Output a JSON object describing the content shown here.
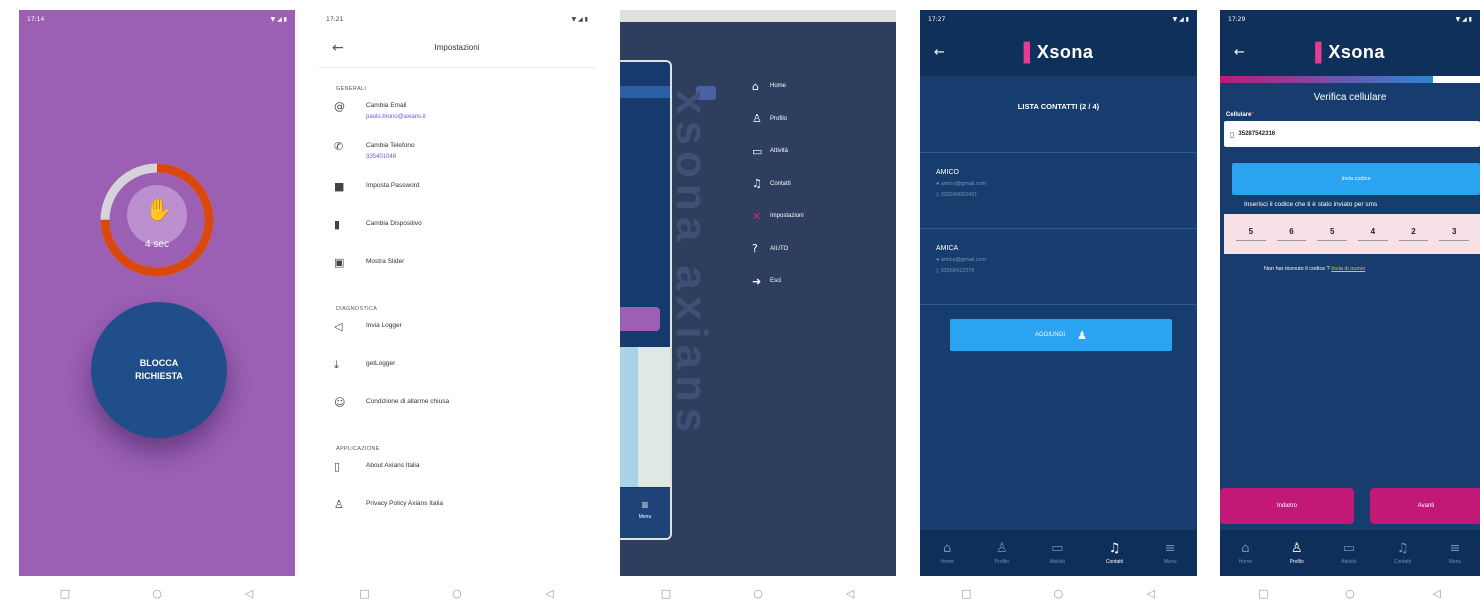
{
  "phone1": {
    "status_time": "17:14",
    "timer_text": "4 sec",
    "timer_progress": 0.75,
    "block_button": "BLOCCA RICHIESTA",
    "colors": {
      "background": "#9b5fb3",
      "ring": "#d9480f",
      "button": "#1f4e8a"
    }
  },
  "phone2": {
    "status_time": "17:21",
    "title": "Impostazioni",
    "sections": {
      "general": "GENERALI",
      "diagnostics": "DIAGNOSTICA",
      "application": "APPLICAZIONE"
    },
    "items": {
      "email": {
        "label": "Cambia Email",
        "value": "paolo.bruno@axians.it",
        "icon": "at-icon"
      },
      "phone": {
        "label": "Cambia Telefono",
        "value": "335401048",
        "icon": "phone-icon"
      },
      "password": {
        "label": "Imposta Password",
        "icon": "lock-icon"
      },
      "device": {
        "label": "Cambia Dispositivo",
        "icon": "device-icon"
      },
      "slider": {
        "label": "Mostra Slider",
        "icon": "image-icon"
      },
      "logger": {
        "label": "Invia Logger",
        "icon": "send-icon"
      },
      "getlogger": {
        "label": "getLogger",
        "icon": "download-icon"
      },
      "alarm": {
        "label": "Condizione di allarme chiusa",
        "icon": "alarm-icon"
      },
      "about": {
        "label": "About Axians Italia",
        "icon": "document-icon"
      },
      "privacy": {
        "label": "Privacy Policy Axians Italia",
        "icon": "person-doc-icon"
      }
    }
  },
  "phone3": {
    "brand_text": "xsona axians",
    "card_menu_label": "Menu",
    "nav": [
      {
        "label": "Home",
        "icon": "home-icon",
        "glyph": "⌂"
      },
      {
        "label": "Profilo",
        "icon": "user-icon",
        "glyph": "♙"
      },
      {
        "label": "Attività",
        "icon": "folder-icon",
        "glyph": "▭"
      },
      {
        "label": "Contatti",
        "icon": "bell-icon",
        "glyph": "♫"
      },
      {
        "label": "Impostazioni",
        "icon": "settings-x-icon",
        "glyph": "✕"
      },
      {
        "label": "AIUTO",
        "icon": "question-icon",
        "glyph": "?"
      },
      {
        "label": "Esci",
        "icon": "exit-icon",
        "glyph": "➜"
      }
    ]
  },
  "phone4": {
    "status_time": "17:27",
    "logo": "Xsona",
    "title": "LISTA CONTATTI  (2 / 4)",
    "contacts": [
      {
        "name": "AMICO",
        "email": "amico@gmail.com",
        "phone": "333249663431"
      },
      {
        "name": "AMICA",
        "email": "amica@gmail.com",
        "phone": "33568412379"
      }
    ],
    "add_button": "AGGIUNGI",
    "tabs": [
      {
        "label": "Home",
        "glyph": "⌂"
      },
      {
        "label": "Profilo",
        "glyph": "♙"
      },
      {
        "label": "Attività",
        "glyph": "▭"
      },
      {
        "label": "Contatti",
        "glyph": "♫"
      },
      {
        "label": "Menu",
        "glyph": "≡"
      }
    ]
  },
  "phone5": {
    "status_time": "17:29",
    "logo": "Xsona",
    "step_progress": 0.82,
    "title": "Verifica cellulare",
    "phone_label": "Cellulare",
    "phone_value": "35287542316",
    "send_button": "Invia codice",
    "hint": "Inserisci il codice che ti è stato inviato per sms",
    "code_digits": [
      "5",
      "6",
      "5",
      "4",
      "2",
      "3"
    ],
    "resend_text": "Non hai ricevuto il codice ? ",
    "resend_link": "Invia di nuovo",
    "back_button": "Indietro",
    "next_button": "Avanti",
    "tabs": [
      {
        "label": "Home",
        "glyph": "⌂"
      },
      {
        "label": "Profilo",
        "glyph": "♙"
      },
      {
        "label": "Attività",
        "glyph": "▭"
      },
      {
        "label": "Contatti",
        "glyph": "♫"
      },
      {
        "label": "Menu",
        "glyph": "≡"
      }
    ]
  },
  "android_nav": {
    "recent": "□",
    "home": "○",
    "back": "◁"
  }
}
